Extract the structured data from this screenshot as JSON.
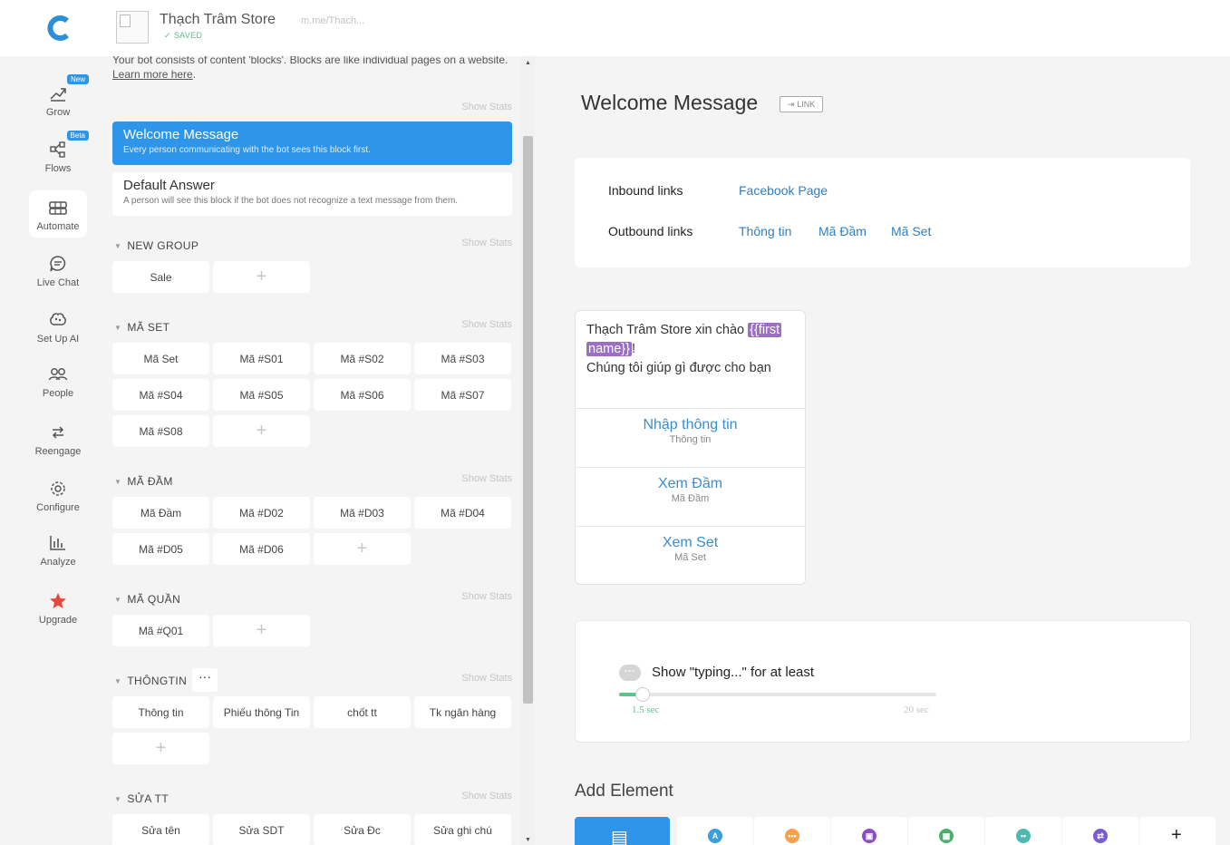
{
  "app": {
    "bot_name": "Thạch Trâm Store",
    "saved_label": "SAVED",
    "bot_url": "m.me/Thach..."
  },
  "nav": [
    {
      "label": "Grow",
      "badge": "New",
      "icon": "grow-icon"
    },
    {
      "label": "Flows",
      "badge": "Beta",
      "icon": "flows-icon"
    },
    {
      "label": "Automate",
      "badge": "",
      "icon": "automate-icon"
    },
    {
      "label": "Live Chat",
      "badge": "",
      "icon": "live-chat-icon"
    },
    {
      "label": "Set Up AI",
      "badge": "",
      "icon": "ai-brain-icon"
    },
    {
      "label": "People",
      "badge": "",
      "icon": "people-icon"
    },
    {
      "label": "Reengage",
      "badge": "",
      "icon": "reengage-icon"
    },
    {
      "label": "Configure",
      "badge": "",
      "icon": "gear-icon"
    },
    {
      "label": "Analyze",
      "badge": "",
      "icon": "chart-icon"
    },
    {
      "label": "Upgrade",
      "badge": "",
      "icon": "star-icon"
    }
  ],
  "blocks": {
    "intro_text": "Your bot consists of content 'blocks'. Blocks are like individual pages on a website.",
    "learn_more": "Learn more here",
    "show_stats": "Show Stats",
    "welcome": {
      "title": "Welcome Message",
      "subtitle": "Every person communicating with the bot sees this block first."
    },
    "default": {
      "title": "Default Answer",
      "subtitle": "A person will see this block if the bot does not recognize a text message from them."
    },
    "groups": [
      {
        "name": "NEW GROUP",
        "items": [
          "Sale"
        ]
      },
      {
        "name": "MÃ SET",
        "items": [
          "Mã Set",
          "Mã #S01",
          "Mã #S02",
          "Mã #S03",
          "Mã #S04",
          "Mã #S05",
          "Mã #S06",
          "Mã #S07",
          "Mã #S08"
        ]
      },
      {
        "name": "MÃ ĐẦM",
        "items": [
          "Mã Đầm",
          "Mã #D02",
          "Mã #D03",
          "Mã #D04",
          "Mã #D05",
          "Mã #D06"
        ]
      },
      {
        "name": "MÃ QUẦN",
        "items": [
          "Mã #Q01"
        ]
      },
      {
        "name": "THÔNGTIN",
        "items": [
          "Thông tin",
          "Phiếu thông Tin",
          "chốt tt",
          "Tk ngân hàng"
        ]
      },
      {
        "name": "SỬA TT",
        "items": [
          "Sửa tên",
          "Sửa SDT",
          "Sửa Đc",
          "Sửa ghi chú"
        ]
      }
    ]
  },
  "editor": {
    "title": "Welcome Message",
    "link_label": "LINK",
    "inbound_label": "Inbound links",
    "inbound": [
      "Facebook Page"
    ],
    "outbound_label": "Outbound links",
    "outbound": [
      "Thông tin",
      "Mã Đầm",
      "Mã Set"
    ],
    "message": {
      "line1": "Thạch Trâm Store xin chào ",
      "var_part1": "{{first",
      "var_part2": "name}}",
      "bang": "!",
      "line2": " Chúng tôi giúp gì được cho bạn",
      "buttons": [
        {
          "title": "Nhập thông tin",
          "target": "Thông tin"
        },
        {
          "title": "Xem Đầm",
          "target": "Mã Đầm"
        },
        {
          "title": "Xem Set",
          "target": "Mã Set"
        }
      ]
    },
    "typing": {
      "label": "Show \"typing...\" for at least",
      "value": 1.5,
      "min_label": "1.5 sec",
      "max_label": "20 sec",
      "max": 20
    },
    "add_element_label": "Add Element",
    "elements": [
      {
        "icon": "text-card-icon",
        "color": "#2f95e8"
      },
      {
        "icon": "typing-text-icon",
        "color": "#3b9ee0"
      },
      {
        "icon": "chat-bubble-icon",
        "color": "#f5a04a"
      },
      {
        "icon": "image-icon",
        "color": "#8b4cc4"
      },
      {
        "icon": "gallery-icon",
        "color": "#4caf6e"
      },
      {
        "icon": "quick-reply-icon",
        "color": "#4fb8b0"
      },
      {
        "icon": "redirect-icon",
        "color": "#7c5ad6"
      },
      {
        "icon": "plus-icon",
        "color": "#222222"
      }
    ]
  }
}
